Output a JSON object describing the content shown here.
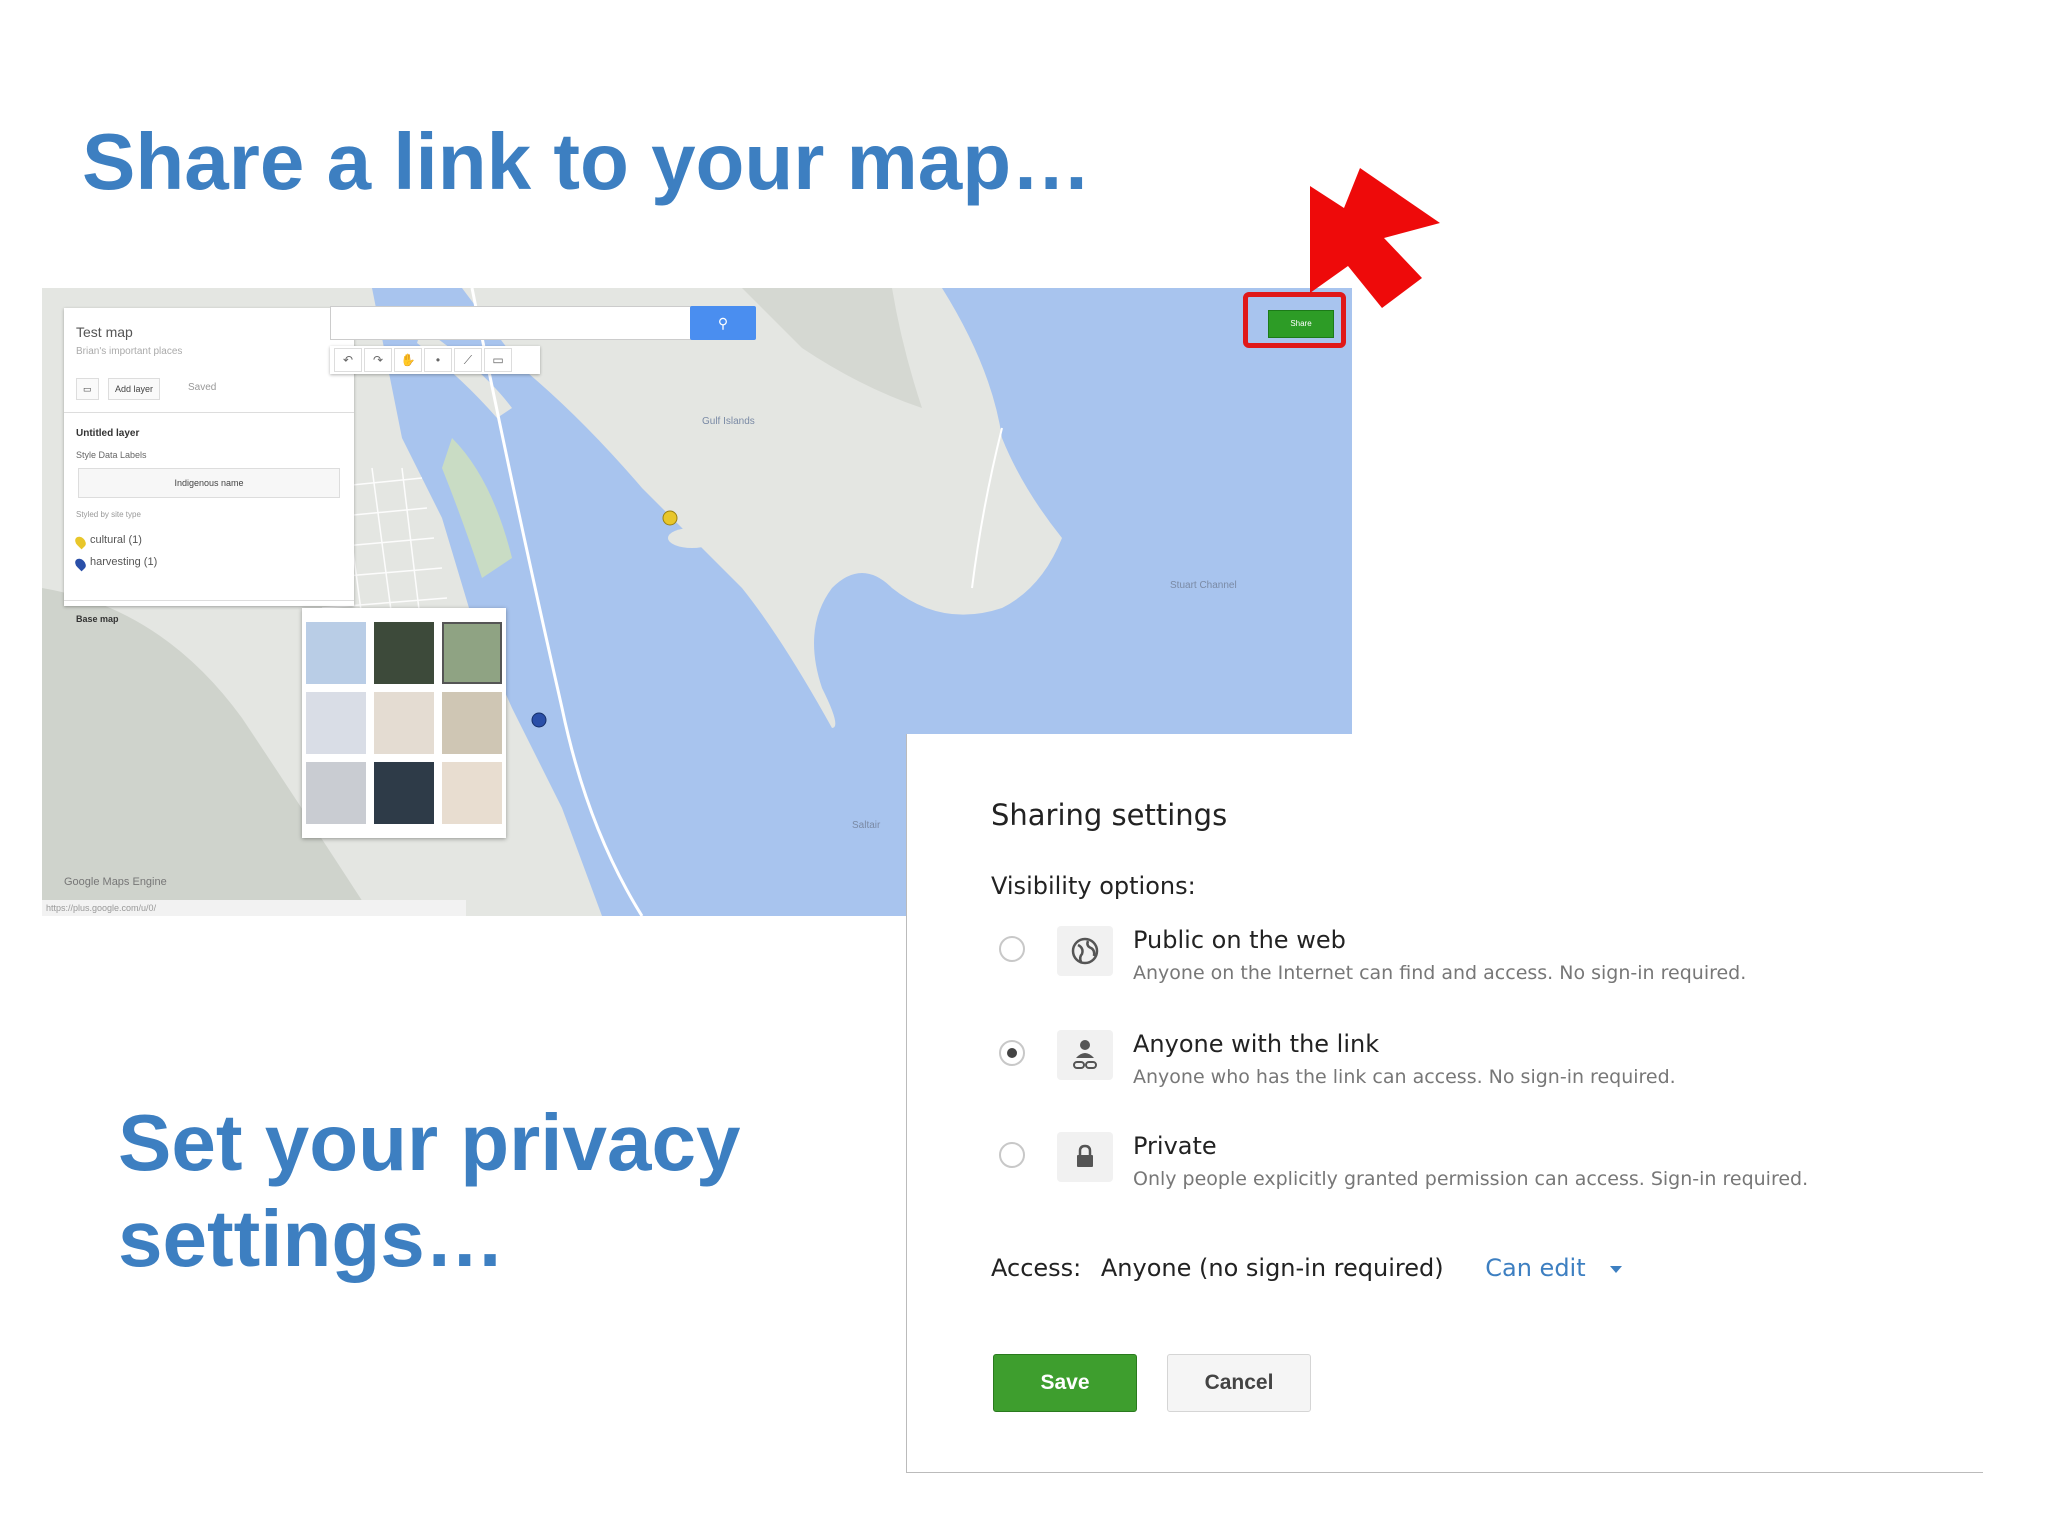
{
  "slide": {
    "title_top": "Share a link to your map…",
    "title_bottom": "Set your privacy settings…"
  },
  "map": {
    "layer_panel": {
      "map_title": "Test map",
      "map_subtitle": "Brian's important places",
      "add_layer": "Add layer",
      "saved": "Saved",
      "layer_name": "Untitled layer",
      "tabs": "Style   Data   Labels",
      "style_select": "Indigenous name",
      "styled_by": "Styled by site type",
      "items": [
        {
          "label": "cultural (1)",
          "color": "#e8c62a"
        },
        {
          "label": "harvesting (1)",
          "color": "#2a4fa8"
        }
      ],
      "base_map": "Base map"
    },
    "share_label": "Share",
    "credit": "Google Maps Engine",
    "url": "https://plus.google.com/u/0/",
    "place_labels": [
      "Stuart Channel",
      "Saltair",
      "Gulf Islands"
    ]
  },
  "dialog": {
    "title": "Sharing settings",
    "visibility_label": "Visibility options:",
    "options": [
      {
        "label": "Public on the web",
        "desc": "Anyone on the Internet can find and access. No sign-in required.",
        "icon": "globe-icon",
        "checked": false
      },
      {
        "label": "Anyone with the link",
        "desc": "Anyone who has the link can access. No sign-in required.",
        "icon": "link-person-icon",
        "checked": true
      },
      {
        "label": "Private",
        "desc": "Only people explicitly granted permission can access. Sign-in required.",
        "icon": "lock-icon",
        "checked": false
      }
    ],
    "access_label": "Access:",
    "access_value": "Anyone (no sign-in required)",
    "permission": "Can edit",
    "save": "Save",
    "cancel": "Cancel"
  },
  "colors": {
    "heading": "#3d7fc1",
    "water": "#a8c4ee",
    "share_green": "#2d9c26",
    "highlight_red": "#e01818"
  }
}
